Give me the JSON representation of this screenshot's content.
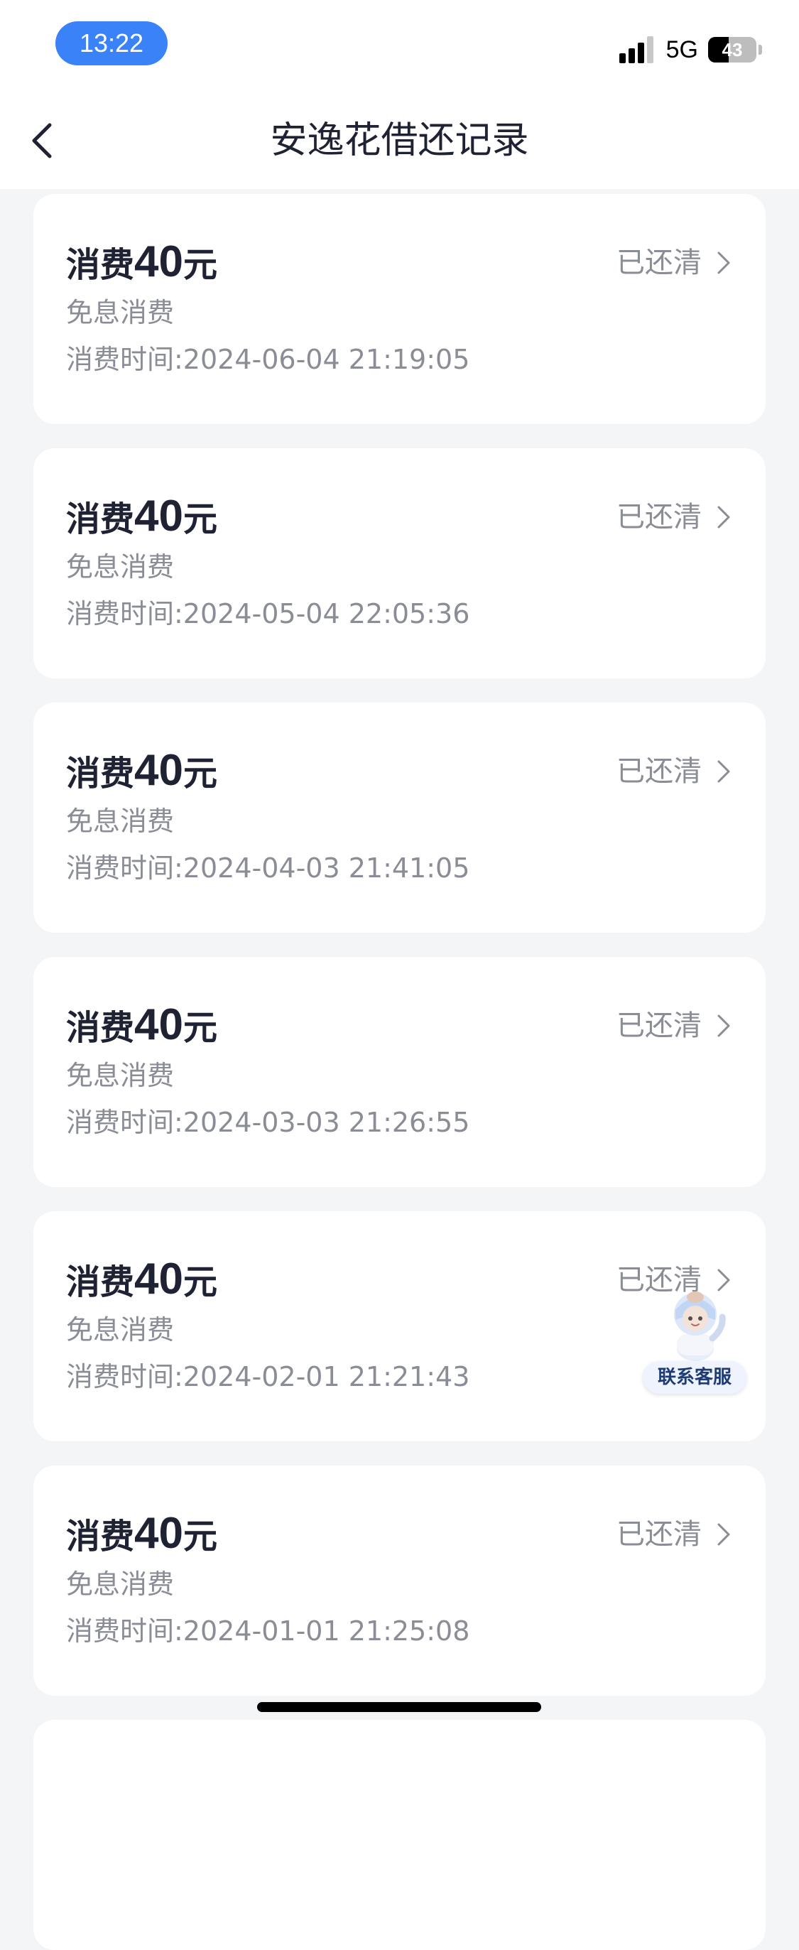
{
  "status_bar": {
    "time": "13:22",
    "network": "5G",
    "battery": "43",
    "battery_level": 0.43
  },
  "header": {
    "title": "安逸花借还记录",
    "back_icon": "chevron-left-icon"
  },
  "records": [
    {
      "title_prefix": "消费",
      "amount": "40",
      "unit": "元",
      "status": "已还清",
      "type": "免息消费",
      "time": "消费时间:2024-06-04 21:19:05"
    },
    {
      "title_prefix": "消费",
      "amount": "40",
      "unit": "元",
      "status": "已还清",
      "type": "免息消费",
      "time": "消费时间:2024-05-04 22:05:36"
    },
    {
      "title_prefix": "消费",
      "amount": "40",
      "unit": "元",
      "status": "已还清",
      "type": "免息消费",
      "time": "消费时间:2024-04-03 21:41:05"
    },
    {
      "title_prefix": "消费",
      "amount": "40",
      "unit": "元",
      "status": "已还清",
      "type": "免息消费",
      "time": "消费时间:2024-03-03 21:26:55"
    },
    {
      "title_prefix": "消费",
      "amount": "40",
      "unit": "元",
      "status": "已还清",
      "type": "免息消费",
      "time": "消费时间:2024-02-01 21:21:43"
    },
    {
      "title_prefix": "消费",
      "amount": "40",
      "unit": "元",
      "status": "已还清",
      "type": "免息消费",
      "time": "消费时间:2024-01-01 21:25:08"
    }
  ],
  "customer_service": {
    "label": "联系客服",
    "icon": "mascot-icon"
  },
  "colors": {
    "time_pill": "#3a82f7",
    "title_text": "#1f2233",
    "secondary_text": "#8a8d96",
    "page_background": "#f4f5f7"
  }
}
